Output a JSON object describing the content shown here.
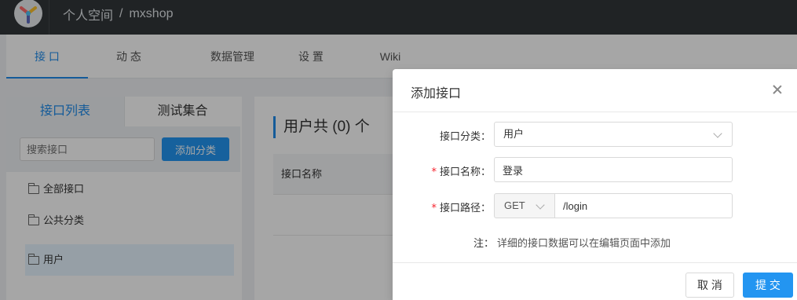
{
  "header": {
    "breadcrumb": [
      "个人空间",
      "mxshop"
    ],
    "separator": "/"
  },
  "tabs": [
    {
      "label": "接 口",
      "active": true
    },
    {
      "label": "动 态",
      "active": false
    },
    {
      "label": "数据管理",
      "active": false
    },
    {
      "label": "设 置",
      "active": false
    },
    {
      "label": "Wiki",
      "active": false
    }
  ],
  "sidebar": {
    "tabs": [
      "接口列表",
      "测试集合"
    ],
    "search_placeholder": "搜索接口",
    "add_button": "添加分类",
    "categories": [
      "全部接口",
      "公共分类",
      "用户"
    ],
    "selected_category": "用户"
  },
  "main": {
    "title": "用户共 (0) 个",
    "column_header": "接口名称"
  },
  "modal": {
    "title": "添加接口",
    "category_label": "接口分类：",
    "category_value": "用户",
    "name_label": "接口名称：",
    "name_value": "登录",
    "path_label": "接口路径：",
    "method_value": "GET",
    "path_value": "/login",
    "note_label": "注：",
    "note_text": "详细的接口数据可以在编辑页面中添加",
    "required_mark": "*",
    "cancel_label": "取 消",
    "submit_label": "提 交"
  },
  "colors": {
    "accent": "#2395f1",
    "header_bg": "#32363a",
    "required": "#f5222d"
  }
}
